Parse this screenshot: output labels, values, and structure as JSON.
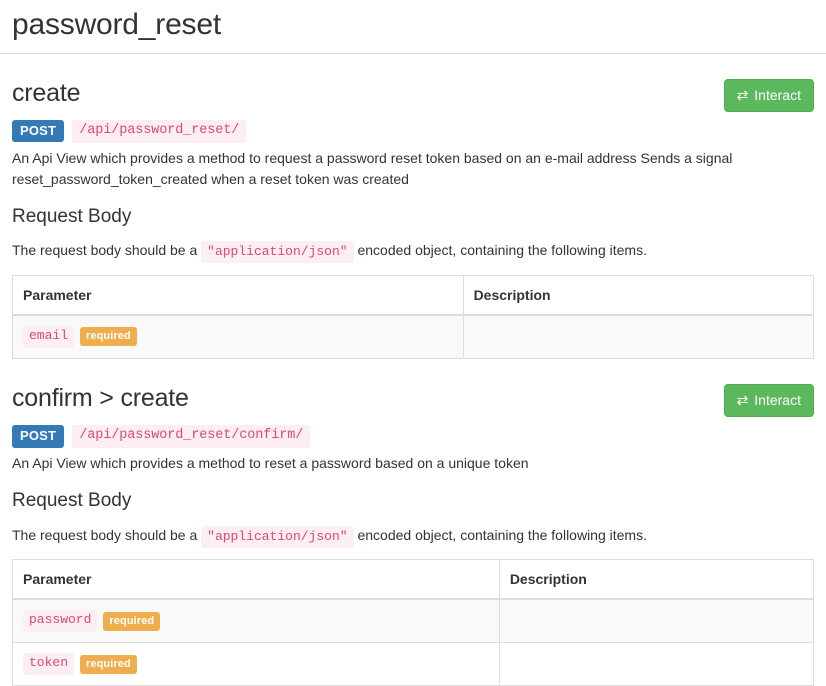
{
  "page": {
    "title": "password_reset"
  },
  "common": {
    "interact_label": "Interact",
    "swap_icon": "⇄",
    "request_body_heading": "Request Body",
    "body_note_prefix": "The request body should be a",
    "body_note_code": "\"application/json\"",
    "body_note_suffix": "encoded object, containing the following items.",
    "required_label": "required",
    "table_headers": {
      "parameter": "Parameter",
      "description": "Description"
    }
  },
  "sections": [
    {
      "heading": "create",
      "method": "POST",
      "path": "/api/password_reset/",
      "description": "An Api View which provides a method to request a password reset token based on an e-mail address Sends a signal reset_password_token_created when a reset token was created",
      "parameters": [
        {
          "name": "email",
          "required": "required",
          "description": ""
        }
      ]
    },
    {
      "heading": "confirm > create",
      "method": "POST",
      "path": "/api/password_reset/confirm/",
      "description": "An Api View which provides a method to reset a password based on a unique token",
      "parameters": [
        {
          "name": "password",
          "required": "required",
          "description": ""
        },
        {
          "name": "token",
          "required": "required",
          "description": ""
        }
      ]
    }
  ],
  "colors": {
    "method_badge_bg": "#337ab7",
    "interact_green": "#5cb85c",
    "required_orange": "#f0ad4e",
    "code_pink": "#e0457b",
    "code_bg": "#fdeef3",
    "table_border": "#dddddd",
    "stripe_bg": "#f9f9f9"
  }
}
